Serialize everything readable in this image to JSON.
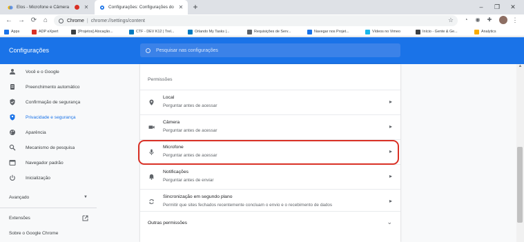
{
  "browser": {
    "tabs": [
      {
        "title": "Elos - Microfone e Câmera",
        "recording": true,
        "close": "✕"
      },
      {
        "title": "Configurações: Configurações do",
        "close": "✕"
      }
    ],
    "new_tab": "+",
    "window_controls": {
      "minimize": "–",
      "maximize": "❐",
      "close": "✕"
    },
    "omnibox": {
      "security_text": "Chrome",
      "separator": "|",
      "url": "chrome://settings/content"
    },
    "star": "☆",
    "bookmarks": [
      {
        "label": "Apps",
        "icon": "apps-grid-icon",
        "color": "#1a73e8"
      },
      {
        "label": "ADP eXpert",
        "icon": "adp-icon",
        "color": "#d93025"
      },
      {
        "label": "[Projetos] Alocação...",
        "icon": "projetos-icon",
        "color": "#3c4043"
      },
      {
        "label": "CTF - DEV K12 | Trel...",
        "icon": "trello-icon",
        "color": "#0079bf"
      },
      {
        "label": "Orlando My Tasks |...",
        "icon": "trello-icon",
        "color": "#0079bf"
      },
      {
        "label": "Requisições de Serv...",
        "icon": "requisicoes-icon",
        "color": "#5f6368"
      },
      {
        "label": "Navegar nos Projet...",
        "icon": "diamond-icon",
        "color": "#1a73e8"
      },
      {
        "label": "Vídeos no Vimeo",
        "icon": "vimeo-icon",
        "color": "#1ab7ea"
      },
      {
        "label": "Início - Gente & Ge...",
        "icon": "globe-icon",
        "color": "#3c4043"
      },
      {
        "label": "Analytics",
        "icon": "analytics-icon",
        "color": "#f9ab00"
      }
    ]
  },
  "settings": {
    "title": "Configurações",
    "search_placeholder": "Pesquisar nas configurações",
    "nav": [
      {
        "label": "Você e o Google",
        "icon": "person-icon",
        "selected": false
      },
      {
        "label": "Preenchimento automático",
        "icon": "clipboard-icon",
        "selected": false
      },
      {
        "label": "Confirmação de segurança",
        "icon": "shield-check-icon",
        "selected": false
      },
      {
        "label": "Privacidade e segurança",
        "icon": "shield-icon",
        "selected": true
      },
      {
        "label": "Aparência",
        "icon": "palette-icon",
        "selected": false
      },
      {
        "label": "Mecanismo de pesquisa",
        "icon": "search-icon",
        "selected": false
      },
      {
        "label": "Navegador padrão",
        "icon": "browser-icon",
        "selected": false
      },
      {
        "label": "Inicialização",
        "icon": "power-icon",
        "selected": false
      }
    ],
    "advanced_label": "Avançado",
    "extensions_label": "Extensões",
    "about_label": "Sobre o Google Chrome",
    "section_label": "Permissões",
    "permissions": [
      {
        "title": "Local",
        "subtitle": "Perguntar antes de acessar",
        "icon": "location-icon"
      },
      {
        "title": "Câmera",
        "subtitle": "Perguntar antes de acessar",
        "icon": "camera-icon"
      },
      {
        "title": "Microfone",
        "subtitle": "Perguntar antes de acessar",
        "icon": "microphone-icon",
        "highlighted": true
      },
      {
        "title": "Notificações",
        "subtitle": "Perguntar antes de enviar",
        "icon": "bell-icon"
      },
      {
        "title": "Sincronização em segundo plano",
        "subtitle": "Permitir que sites fechados recentemente concluam o envio e o recebimento de dados",
        "icon": "sync-icon"
      }
    ],
    "other_permissions_label": "Outras permissões",
    "accent_color": "#1a73e8",
    "highlight_color": "#d93025"
  }
}
